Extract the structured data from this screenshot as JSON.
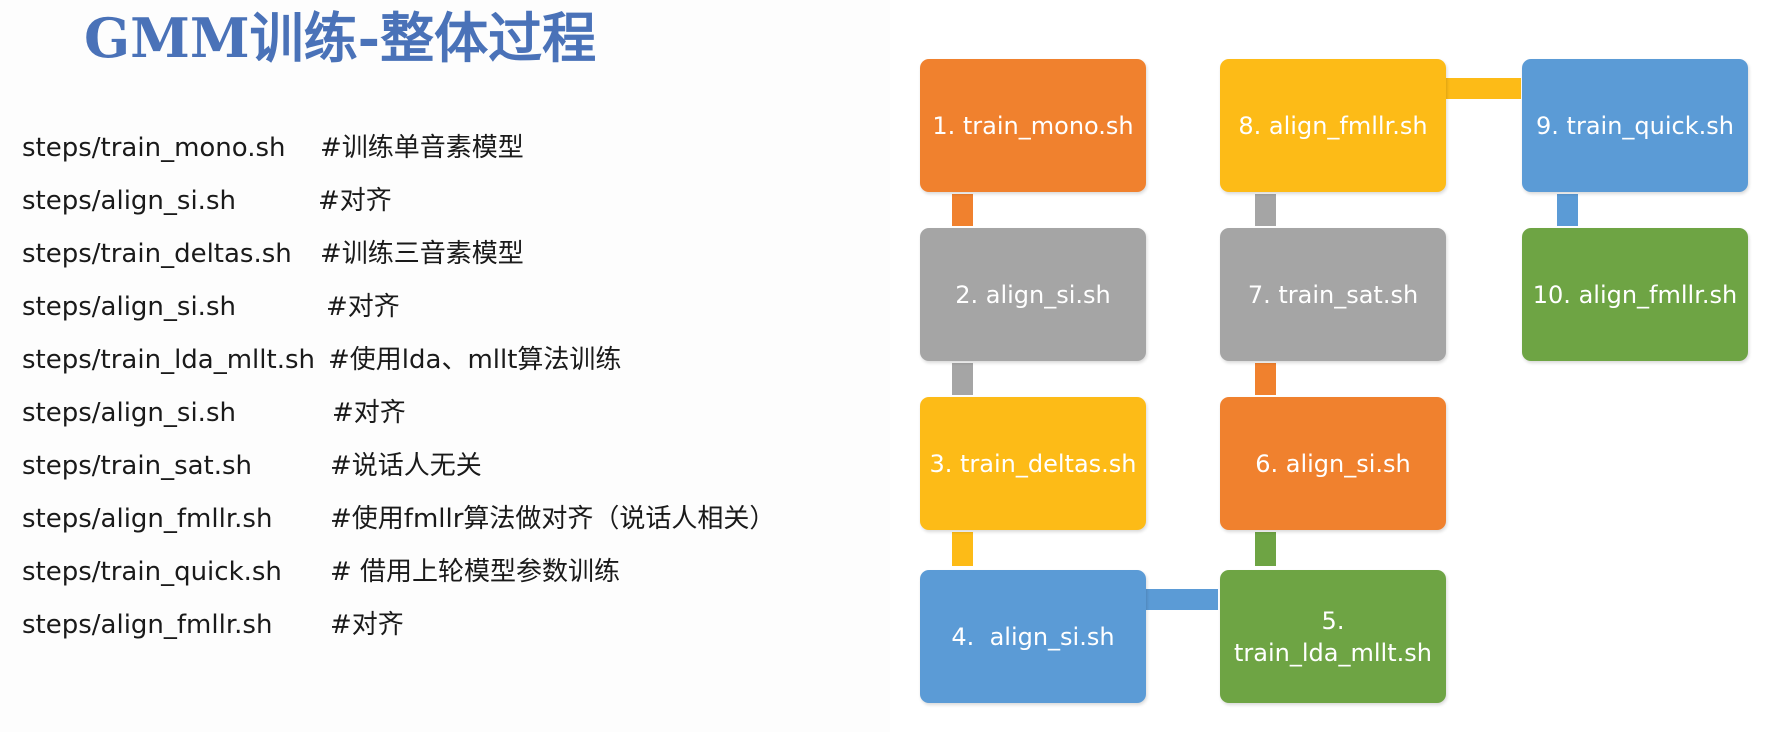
{
  "title": "GMM训练-整体过程",
  "steps": [
    {
      "cmd": "steps/train_mono.sh",
      "comment": "#训练单音素模型"
    },
    {
      "cmd": "steps/align_si.sh",
      "comment": "#对齐"
    },
    {
      "cmd": "steps/train_deltas.sh",
      "comment": "#训练三音素模型"
    },
    {
      "cmd": "steps/align_si.sh",
      "comment": "#对齐"
    },
    {
      "cmd": "steps/train_lda_mllt.sh",
      "comment": "#使用lda、mllt算法训练"
    },
    {
      "cmd": "steps/align_si.sh",
      "comment": "#对齐"
    },
    {
      "cmd": "steps/train_sat.sh",
      "comment": "#说话人无关"
    },
    {
      "cmd": "steps/align_fmllr.sh",
      "comment": "#使用fmllr算法做对齐（说话人相关）"
    },
    {
      "cmd": "steps/train_quick.sh",
      "comment": "# 借用上轮模型参数训练"
    },
    {
      "cmd": "steps/align_fmllr.sh",
      "comment": "#对齐"
    }
  ],
  "flow": {
    "boxes": [
      {
        "label": "1. train_mono.sh",
        "color": "#f0812e"
      },
      {
        "label": "2. align_si.sh",
        "color": "#a5a5a5"
      },
      {
        "label": "3. train_deltas.sh",
        "color": "#fdbb17"
      },
      {
        "label": "4.  align_si.sh",
        "color": "#5b9bd6"
      },
      {
        "label_line1": "5.",
        "label_line2": "train_lda_mllt.sh",
        "color": "#6ea444"
      },
      {
        "label": "6. align_si.sh",
        "color": "#f0812e"
      },
      {
        "label": "7. train_sat.sh",
        "color": "#a5a5a5"
      },
      {
        "label": "8. align_fmllr.sh",
        "color": "#fdbb17"
      },
      {
        "label": "9. train_quick.sh",
        "color": "#5b9bd6"
      },
      {
        "label": "10. align_fmllr.sh",
        "color": "#6ea444"
      }
    ]
  }
}
